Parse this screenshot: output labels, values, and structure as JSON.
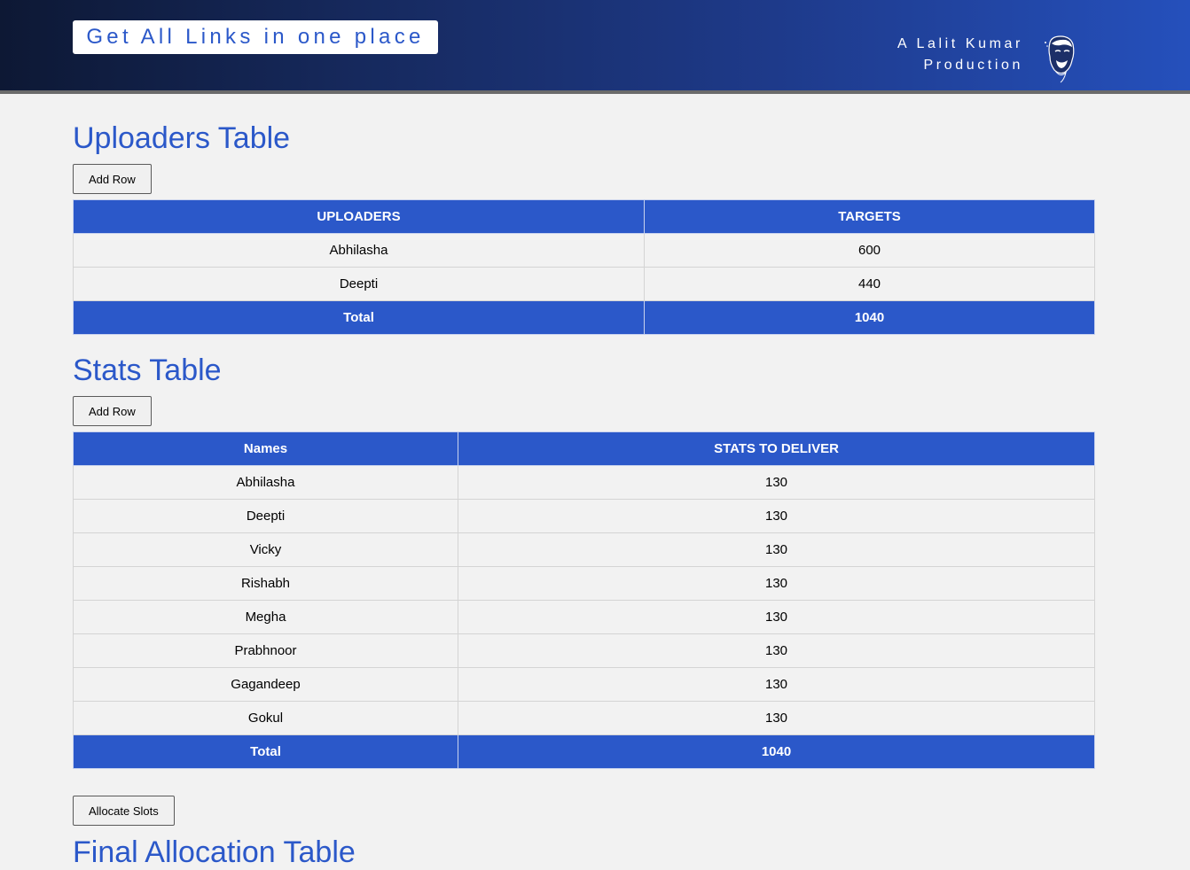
{
  "header": {
    "brand": "Get All Links in one place",
    "credit_line1": "A Lalit Kumar",
    "credit_line2": "Production"
  },
  "uploaders": {
    "title": "Uploaders Table",
    "add_row_label": "Add Row",
    "columns": [
      "UPLOADERS",
      "TARGETS"
    ],
    "rows": [
      {
        "name": "Abhilasha",
        "value": "600"
      },
      {
        "name": "Deepti",
        "value": "440"
      }
    ],
    "total": {
      "label": "Total",
      "value": "1040"
    }
  },
  "stats": {
    "title": "Stats Table",
    "add_row_label": "Add Row",
    "columns": [
      "Names",
      "STATS TO DELIVER"
    ],
    "rows": [
      {
        "name": "Abhilasha",
        "value": "130"
      },
      {
        "name": "Deepti",
        "value": "130"
      },
      {
        "name": "Vicky",
        "value": "130"
      },
      {
        "name": "Rishabh",
        "value": "130"
      },
      {
        "name": "Megha",
        "value": "130"
      },
      {
        "name": "Prabhnoor",
        "value": "130"
      },
      {
        "name": "Gagandeep",
        "value": "130"
      },
      {
        "name": "Gokul",
        "value": "130"
      }
    ],
    "total": {
      "label": "Total",
      "value": "1040"
    }
  },
  "allocate_label": "Allocate Slots",
  "final": {
    "title": "Final Allocation Table"
  }
}
